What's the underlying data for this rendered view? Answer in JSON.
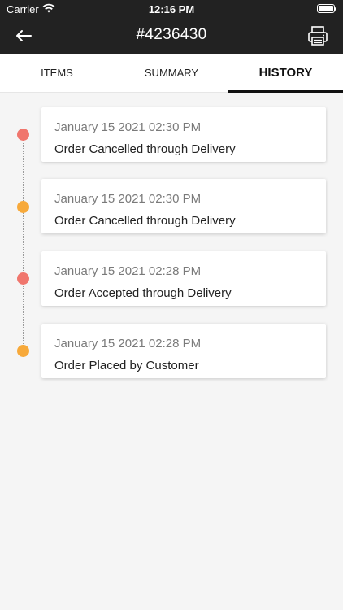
{
  "status_bar": {
    "carrier": "Carrier",
    "time": "12:16 PM"
  },
  "nav": {
    "title": "#4236430",
    "back_icon": "back-arrow-icon",
    "print_icon": "printer-icon"
  },
  "tabs": [
    {
      "label": "ITEMS",
      "active": false
    },
    {
      "label": "SUMMARY",
      "active": false
    },
    {
      "label": "HISTORY",
      "active": true
    }
  ],
  "history": [
    {
      "date": "January 15 2021 02:30 PM",
      "event": "Order Cancelled through Delivery",
      "dot_color": "#f0766d"
    },
    {
      "date": "January 15 2021 02:30 PM",
      "event": "Order Cancelled through Delivery",
      "dot_color": "#f7a93a"
    },
    {
      "date": "January 15 2021 02:28 PM",
      "event": "Order Accepted through Delivery",
      "dot_color": "#f0766d"
    },
    {
      "date": "January 15 2021 02:28 PM",
      "event": "Order Placed by Customer",
      "dot_color": "#f7a93a"
    }
  ],
  "colors": {
    "header_bg": "#222222",
    "page_bg": "#f5f5f5",
    "active_tab": "#111111"
  }
}
